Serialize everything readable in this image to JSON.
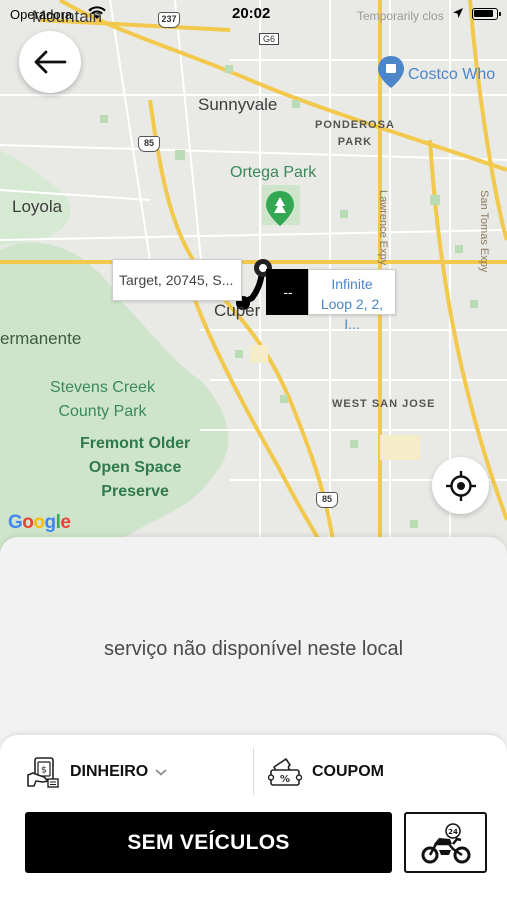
{
  "status_bar": {
    "carrier": "Operadora",
    "time": "20:02"
  },
  "map": {
    "labels": {
      "mountain_view": "Mountain\nView",
      "sunnyvale": "Sunnyvale",
      "ponderosa_park": "PONDEROSA\nPARK",
      "ortega_park": "Ortega Park",
      "loyola": "Loyola",
      "cupertino": "Cuper",
      "permanente": "ermanente",
      "stevens_creek": "Stevens Creek\nCounty Park",
      "fremont_older": "Fremont Older\nOpen Space\nPreserve",
      "west_san_jose": "WEST SAN JOSE",
      "costco": "Costco Who",
      "temporarily_closed": "Temporarily clos",
      "lawrence_expy": "Lawrence Expy",
      "san_tomas_expy": "San Tomas Expy",
      "google": "Google"
    },
    "shields": {
      "hwy_237": "237",
      "hwy_85_top": "85",
      "hwy_85_bottom": "85",
      "g6": "G6"
    },
    "origin_marker_text": "Target, 20745, S...",
    "destination_marker_text": "Infinite Loop 2, 2, I...",
    "eta_text": "--"
  },
  "sheet": {
    "unavailable_message": "serviço não disponível neste local"
  },
  "payment": {
    "method_label": "DINHEIRO",
    "coupon_label": "COUPOM"
  },
  "actions": {
    "main_button_label": "SEM VEÍCULOS"
  },
  "icons": {
    "back": "back-arrow-icon",
    "locate": "crosshair-icon",
    "cash": "cash-icon",
    "coupon": "coupon-icon",
    "vehicle": "motorcycle-24h-icon",
    "wifi": "wifi-icon",
    "battery": "battery-icon"
  },
  "colors": {
    "map_bg": "#e9e9e6",
    "highway": "#f2c94c",
    "park": "#c8e3c5",
    "primary_button": "#000000"
  }
}
